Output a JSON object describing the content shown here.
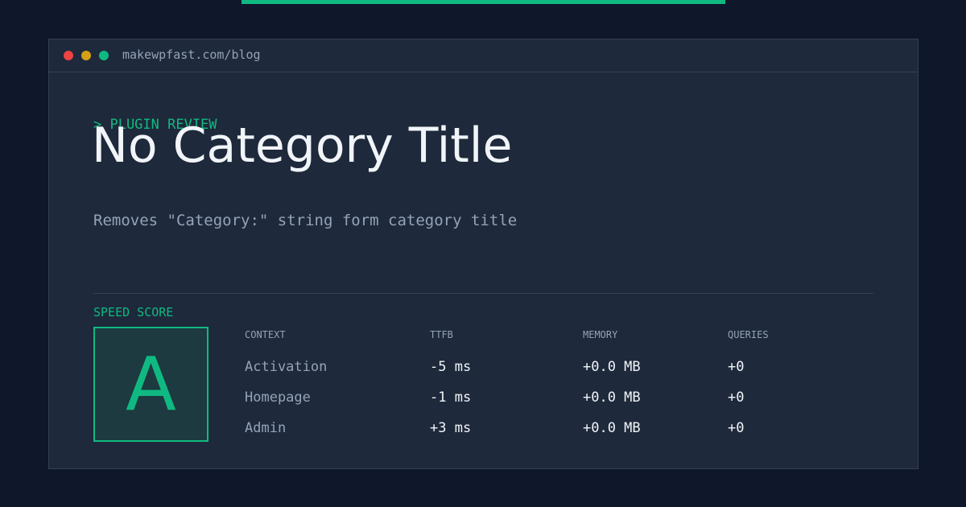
{
  "colors": {
    "background": "#0f172a",
    "panel": "#1e293b",
    "accent": "#10b981",
    "muted_text": "#94a3b8",
    "primary_text": "#f1f5f9",
    "dot_red": "#ef4444",
    "dot_yellow": "#d4a017",
    "dot_green": "#10b981"
  },
  "window": {
    "url": "makewpfast.com/blog",
    "dots": [
      "close-dot",
      "minimize-dot",
      "maximize-dot"
    ]
  },
  "hero": {
    "kicker": "> PLUGIN REVIEW",
    "title": "No Category Title",
    "description": "Removes \"Category:\" string form category title"
  },
  "score": {
    "label": "SPEED SCORE",
    "grade": "A"
  },
  "table": {
    "headers": {
      "context": "CONTEXT",
      "ttfb": "TTFB",
      "memory": "MEMORY",
      "queries": "QUERIES"
    },
    "rows": [
      {
        "context": "Activation",
        "ttfb": "-5 ms",
        "memory": "+0.0 MB",
        "queries": "+0"
      },
      {
        "context": "Homepage",
        "ttfb": "-1 ms",
        "memory": "+0.0 MB",
        "queries": "+0"
      },
      {
        "context": "Admin",
        "ttfb": "+3 ms",
        "memory": "+0.0 MB",
        "queries": "+0"
      }
    ]
  }
}
